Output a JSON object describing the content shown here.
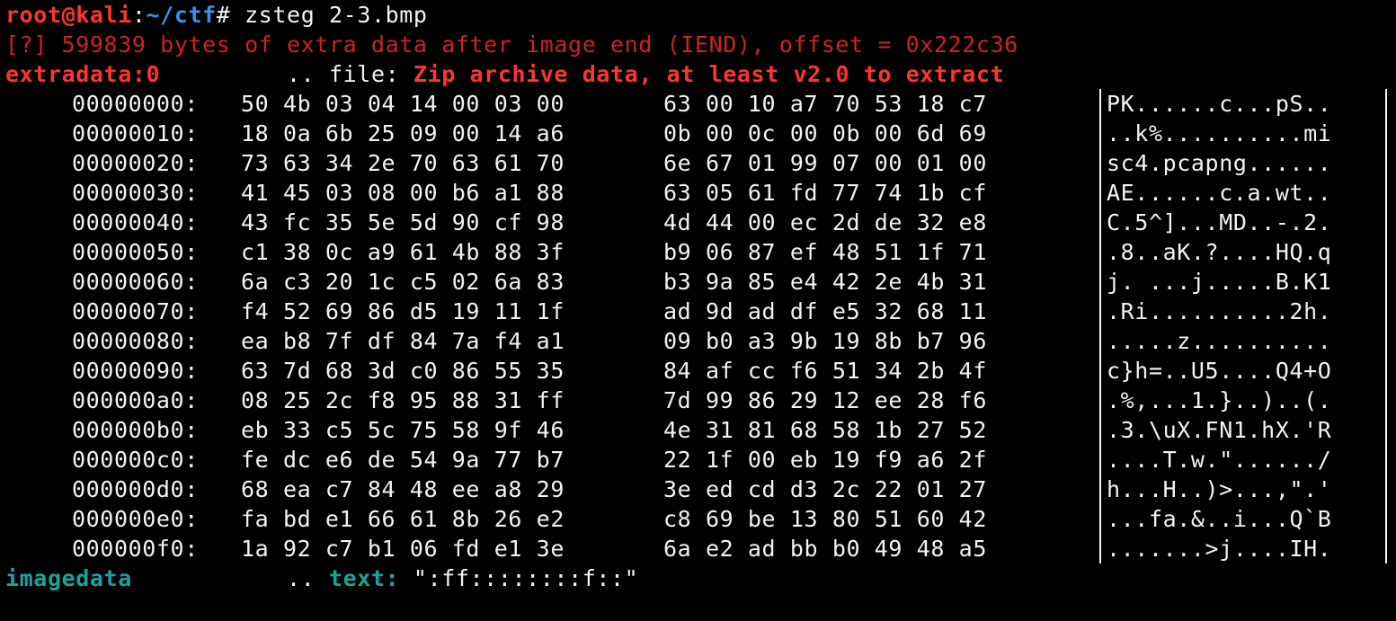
{
  "prompt": {
    "user_host": "root@kali",
    "separator": ":",
    "path": "~/ctf",
    "symbol": "#",
    "command": " zsteg 2-3.bmp"
  },
  "messages": {
    "warning": "[?] 599839 bytes of extra data after image end (IEND), offset = 0x222c36",
    "extradata_label": "extradata:0",
    "extradata_sep": "         .. file: ",
    "extradata_value": "Zip archive data, at least v2.0 to extract"
  },
  "hexdump": [
    {
      "offset": "00000000:",
      "b1": "50 4b 03 04 14 00 03 00",
      "b2": "63 00 10 a7 70 53 18 c7",
      "ascii": "PK......c...pS.."
    },
    {
      "offset": "00000010:",
      "b1": "18 0a 6b 25 09 00 14 a6",
      "b2": "0b 00 0c 00 0b 00 6d 69",
      "ascii": "..k%..........mi"
    },
    {
      "offset": "00000020:",
      "b1": "73 63 34 2e 70 63 61 70",
      "b2": "6e 67 01 99 07 00 01 00",
      "ascii": "sc4.pcapng......"
    },
    {
      "offset": "00000030:",
      "b1": "41 45 03 08 00 b6 a1 88",
      "b2": "63 05 61 fd 77 74 1b cf",
      "ascii": "AE......c.a.wt.."
    },
    {
      "offset": "00000040:",
      "b1": "43 fc 35 5e 5d 90 cf 98",
      "b2": "4d 44 00 ec 2d de 32 e8",
      "ascii": "C.5^]...MD..-.2."
    },
    {
      "offset": "00000050:",
      "b1": "c1 38 0c a9 61 4b 88 3f",
      "b2": "b9 06 87 ef 48 51 1f 71",
      "ascii": ".8..aK.?....HQ.q"
    },
    {
      "offset": "00000060:",
      "b1": "6a c3 20 1c c5 02 6a 83",
      "b2": "b3 9a 85 e4 42 2e 4b 31",
      "ascii": "j. ...j.....B.K1"
    },
    {
      "offset": "00000070:",
      "b1": "f4 52 69 86 d5 19 11 1f",
      "b2": "ad 9d ad df e5 32 68 11",
      "ascii": ".Ri..........2h."
    },
    {
      "offset": "00000080:",
      "b1": "ea b8 7f df 84 7a f4 a1",
      "b2": "09 b0 a3 9b 19 8b b7 96",
      "ascii": ".....z.........."
    },
    {
      "offset": "00000090:",
      "b1": "63 7d 68 3d c0 86 55 35",
      "b2": "84 af cc f6 51 34 2b 4f",
      "ascii": "c}h=..U5....Q4+O"
    },
    {
      "offset": "000000a0:",
      "b1": "08 25 2c f8 95 88 31 ff",
      "b2": "7d 99 86 29 12 ee 28 f6",
      "ascii": ".%,...1.}..)..(."
    },
    {
      "offset": "000000b0:",
      "b1": "eb 33 c5 5c 75 58 9f 46",
      "b2": "4e 31 81 68 58 1b 27 52",
      "ascii": ".3.\\uX.FN1.hX.'R"
    },
    {
      "offset": "000000c0:",
      "b1": "fe dc e6 de 54 9a 77 b7",
      "b2": "22 1f 00 eb 19 f9 a6 2f",
      "ascii": "....T.w.\"....../"
    },
    {
      "offset": "000000d0:",
      "b1": "68 ea c7 84 48 ee a8 29",
      "b2": "3e ed cd d3 2c 22 01 27",
      "ascii": "h...H..)>...,\".'"
    },
    {
      "offset": "000000e0:",
      "b1": "fa bd e1 66 61 8b 26 e2",
      "b2": "c8 69 be 13 80 51 60 42",
      "ascii": "...fa.&..i...Q`B"
    },
    {
      "offset": "000000f0:",
      "b1": "1a 92 c7 b1 06 fd e1 3e",
      "b2": "6a e2 ad bb b0 49 48 a5",
      "ascii": ".......>j....IH."
    }
  ],
  "imagedata": {
    "label": "imagedata",
    "sep": "           .. ",
    "text_label": "text:",
    "text_value": " \":ff::::::::f::\""
  },
  "colors": {
    "background": "#000000",
    "prompt_red": "#ff3333",
    "path_blue": "#3b8eea",
    "label_teal": "#1aa39e",
    "text_white": "#f2f2f2"
  }
}
